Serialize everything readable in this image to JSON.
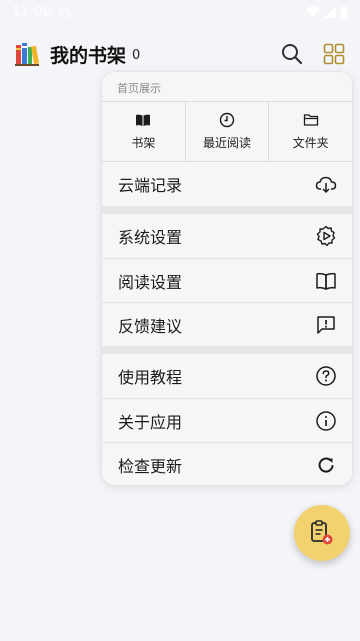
{
  "status_bar": {
    "time": "11:00"
  },
  "header": {
    "title": "我的书架",
    "count": "0"
  },
  "menu": {
    "section_label": "首页展示",
    "tabs": [
      {
        "label": "书架",
        "icon": "book-open-icon"
      },
      {
        "label": "最近阅读",
        "icon": "clock-icon"
      },
      {
        "label": "文件夹",
        "icon": "folder-icon"
      }
    ],
    "items": [
      {
        "label": "云端记录",
        "icon": "cloud-download-icon"
      },
      {
        "label": "系统设置",
        "icon": "gear-play-icon"
      },
      {
        "label": "阅读设置",
        "icon": "book-outline-icon"
      },
      {
        "label": "反馈建议",
        "icon": "feedback-icon"
      },
      {
        "label": "使用教程",
        "icon": "help-circle-icon"
      },
      {
        "label": "关于应用",
        "icon": "info-circle-icon"
      },
      {
        "label": "检查更新",
        "icon": "refresh-icon"
      }
    ]
  },
  "colors": {
    "fab": "#f2d26f",
    "background": "#f4f5f8",
    "menu": "#f6f6f6"
  }
}
